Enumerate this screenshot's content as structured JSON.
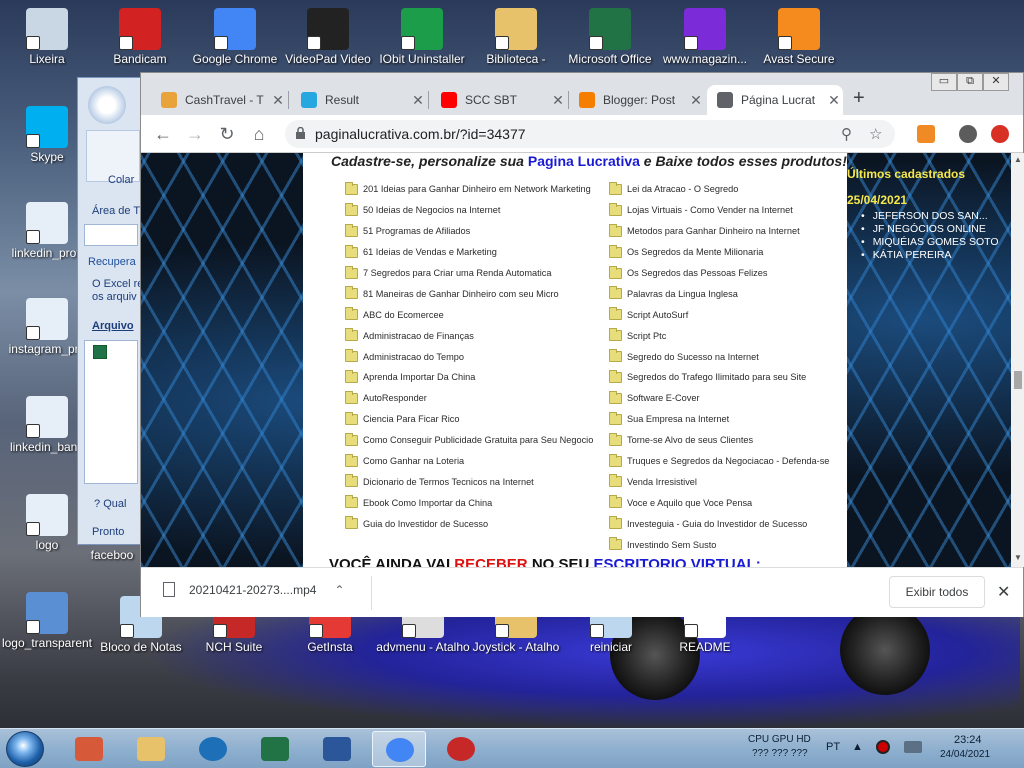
{
  "desktop": {
    "top_icons": [
      {
        "label": "Lixeira",
        "color": "#c9d6e4"
      },
      {
        "label": "Bandicam",
        "color": "#d22222"
      },
      {
        "label": "Google Chrome",
        "color": "#4285f4"
      },
      {
        "label": "VideoPad Video",
        "color": "#222222"
      },
      {
        "label": "IObit Uninstaller",
        "color": "#1b9d4a"
      },
      {
        "label": "Biblioteca -",
        "color": "#e8c26a"
      },
      {
        "label": "Microsoft Office",
        "color": "#217346"
      },
      {
        "label": "www.magazin...",
        "color": "#7b2bd8"
      },
      {
        "label": "Avast Secure",
        "color": "#f58a1f"
      }
    ],
    "left_icons": [
      {
        "label": "Skype",
        "color": "#00aff0"
      },
      {
        "label": "linkedin_profi",
        "color": "#e6eef7"
      },
      {
        "label": "instagram_pro",
        "color": "#e6eef7"
      },
      {
        "label": "linkedin_bann",
        "color": "#e6eef7"
      },
      {
        "label": "logo",
        "color": "#e6eef7"
      },
      {
        "label": "logo_transparent",
        "color": "#5b8fd4"
      }
    ],
    "bottom_icons": [
      {
        "label": "Bloco de Notas",
        "color": "#bcd7ee"
      },
      {
        "label": "NCH Suite",
        "color": "#c62828"
      },
      {
        "label": "GetInsta",
        "color": "#e53935"
      },
      {
        "label": "advmenu - Atalho",
        "color": "#dddddd"
      },
      {
        "label": "Joystick - Atalho",
        "color": "#e8c26a"
      },
      {
        "label": "reiniciar",
        "color": "#bcd7ee"
      },
      {
        "label": "README",
        "color": "#ffffff"
      }
    ],
    "facebook_partial": "faceboo"
  },
  "excel": {
    "ribbon_label": "Colar",
    "area_label": "Área de T",
    "recover_label": "Recupera",
    "recover_text1": "O Excel re",
    "recover_text2": "os arquiv",
    "files_label": "Arquivo",
    "help_label": "Qual",
    "status": "Pronto"
  },
  "chrome": {
    "tabs": [
      {
        "title": "CashTravel - T",
        "favicon": "#e8a33a"
      },
      {
        "title": "Result",
        "favicon": "#27a7e0"
      },
      {
        "title": "SCC SBT",
        "favicon": "#ff0000"
      },
      {
        "title": "Blogger: Post",
        "favicon": "#f57d00"
      },
      {
        "title": "Página Lucrat",
        "favicon": "#5f6368"
      }
    ],
    "url": "paginalucrativa.com.br/?id=34377",
    "window_controls": [
      "▭",
      "⧉",
      "✕"
    ]
  },
  "page": {
    "headline_pre": "Cadastre-se, personalize sua ",
    "headline_brand": "Pagina Lucrativa",
    "headline_post": "  e Baixe todos esses produtos!",
    "left_items": [
      "201 Ideias para Ganhar Dinheiro em Network Marketing",
      "50 Ideias de Negocios na Internet",
      "51 Programas de Afiliados",
      "61 Ideias de Vendas e Marketing",
      "7 Segredos para Criar uma Renda Automatica",
      "81 Maneiras de Ganhar Dinheiro com seu Micro",
      "ABC do Ecomercee",
      "Administracao de Finanças",
      "Administracao do Tempo",
      "Aprenda Importar Da China",
      "AutoResponder",
      "Ciencia Para Ficar Rico",
      "Como Conseguir Publicidade Gratuita para Seu Negocio",
      "Como Ganhar na Loteria",
      "Dicionario de Termos Tecnicos na Internet",
      "Ebook Como Importar da China",
      "Guia do Investidor de Sucesso"
    ],
    "right_items": [
      "Lei da Atracao - O Segredo",
      "Lojas Virtuais - Como Vender na Internet",
      "Metodos para Ganhar Dinheiro na Internet",
      "Os Segredos da Mente Milionaria",
      "Os Segredos das Pessoas Felizes",
      "Palavras da Lingua Inglesa",
      "Script AutoSurf",
      "Script Ptc",
      "Segredo do Sucesso na Internet",
      "Segredos do Trafego Ilimitado para seu Site",
      "Software E-Cover",
      "Sua Empresa na Internet",
      "Torne-se Alvo de seus Clientes",
      "Truques e Segredos da Negociacao - Defenda-se",
      "Venda Irresistivel",
      "Voce e Aquilo que Voce Pensa",
      "Investeguia - Guia do Investidor de Sucesso",
      "Investindo Sem Susto"
    ],
    "banner_a": "VOCÊ AINDA VAI ",
    "banner_b": "RECEBER",
    "banner_c": " NO SEU ",
    "banner_d": "ESCRITORIO VIRTUAL:",
    "sidebar_title": "Últimos cadastrados",
    "sidebar_date": "25/04/2021",
    "recent_signups": [
      "JEFERSON DOS SAN...",
      "JF NEGÓCIOS ONLINE",
      "MIQUÉIAS GOMES SOTO",
      "KÁTIA PEREIRA"
    ]
  },
  "downloads": {
    "file": "20210421-20273....mp4",
    "show_all": "Exibir todos"
  },
  "taskbar": {
    "apps": [
      {
        "name": "bandicam",
        "color": "#d65a3a"
      },
      {
        "name": "explorer",
        "color": "#e8c26a"
      },
      {
        "name": "ccleaner",
        "color": "#1d6fb8"
      },
      {
        "name": "excel",
        "color": "#217346"
      },
      {
        "name": "word",
        "color": "#2b579a"
      },
      {
        "name": "chrome",
        "color": "#4285f4"
      },
      {
        "name": "bandicam-rec",
        "color": "#c62828"
      }
    ],
    "cpu_label": "CPU GPU HD",
    "cpu_values": "???   ???  ???",
    "lang": "PT",
    "time": "23:24",
    "date": "24/04/2021"
  }
}
